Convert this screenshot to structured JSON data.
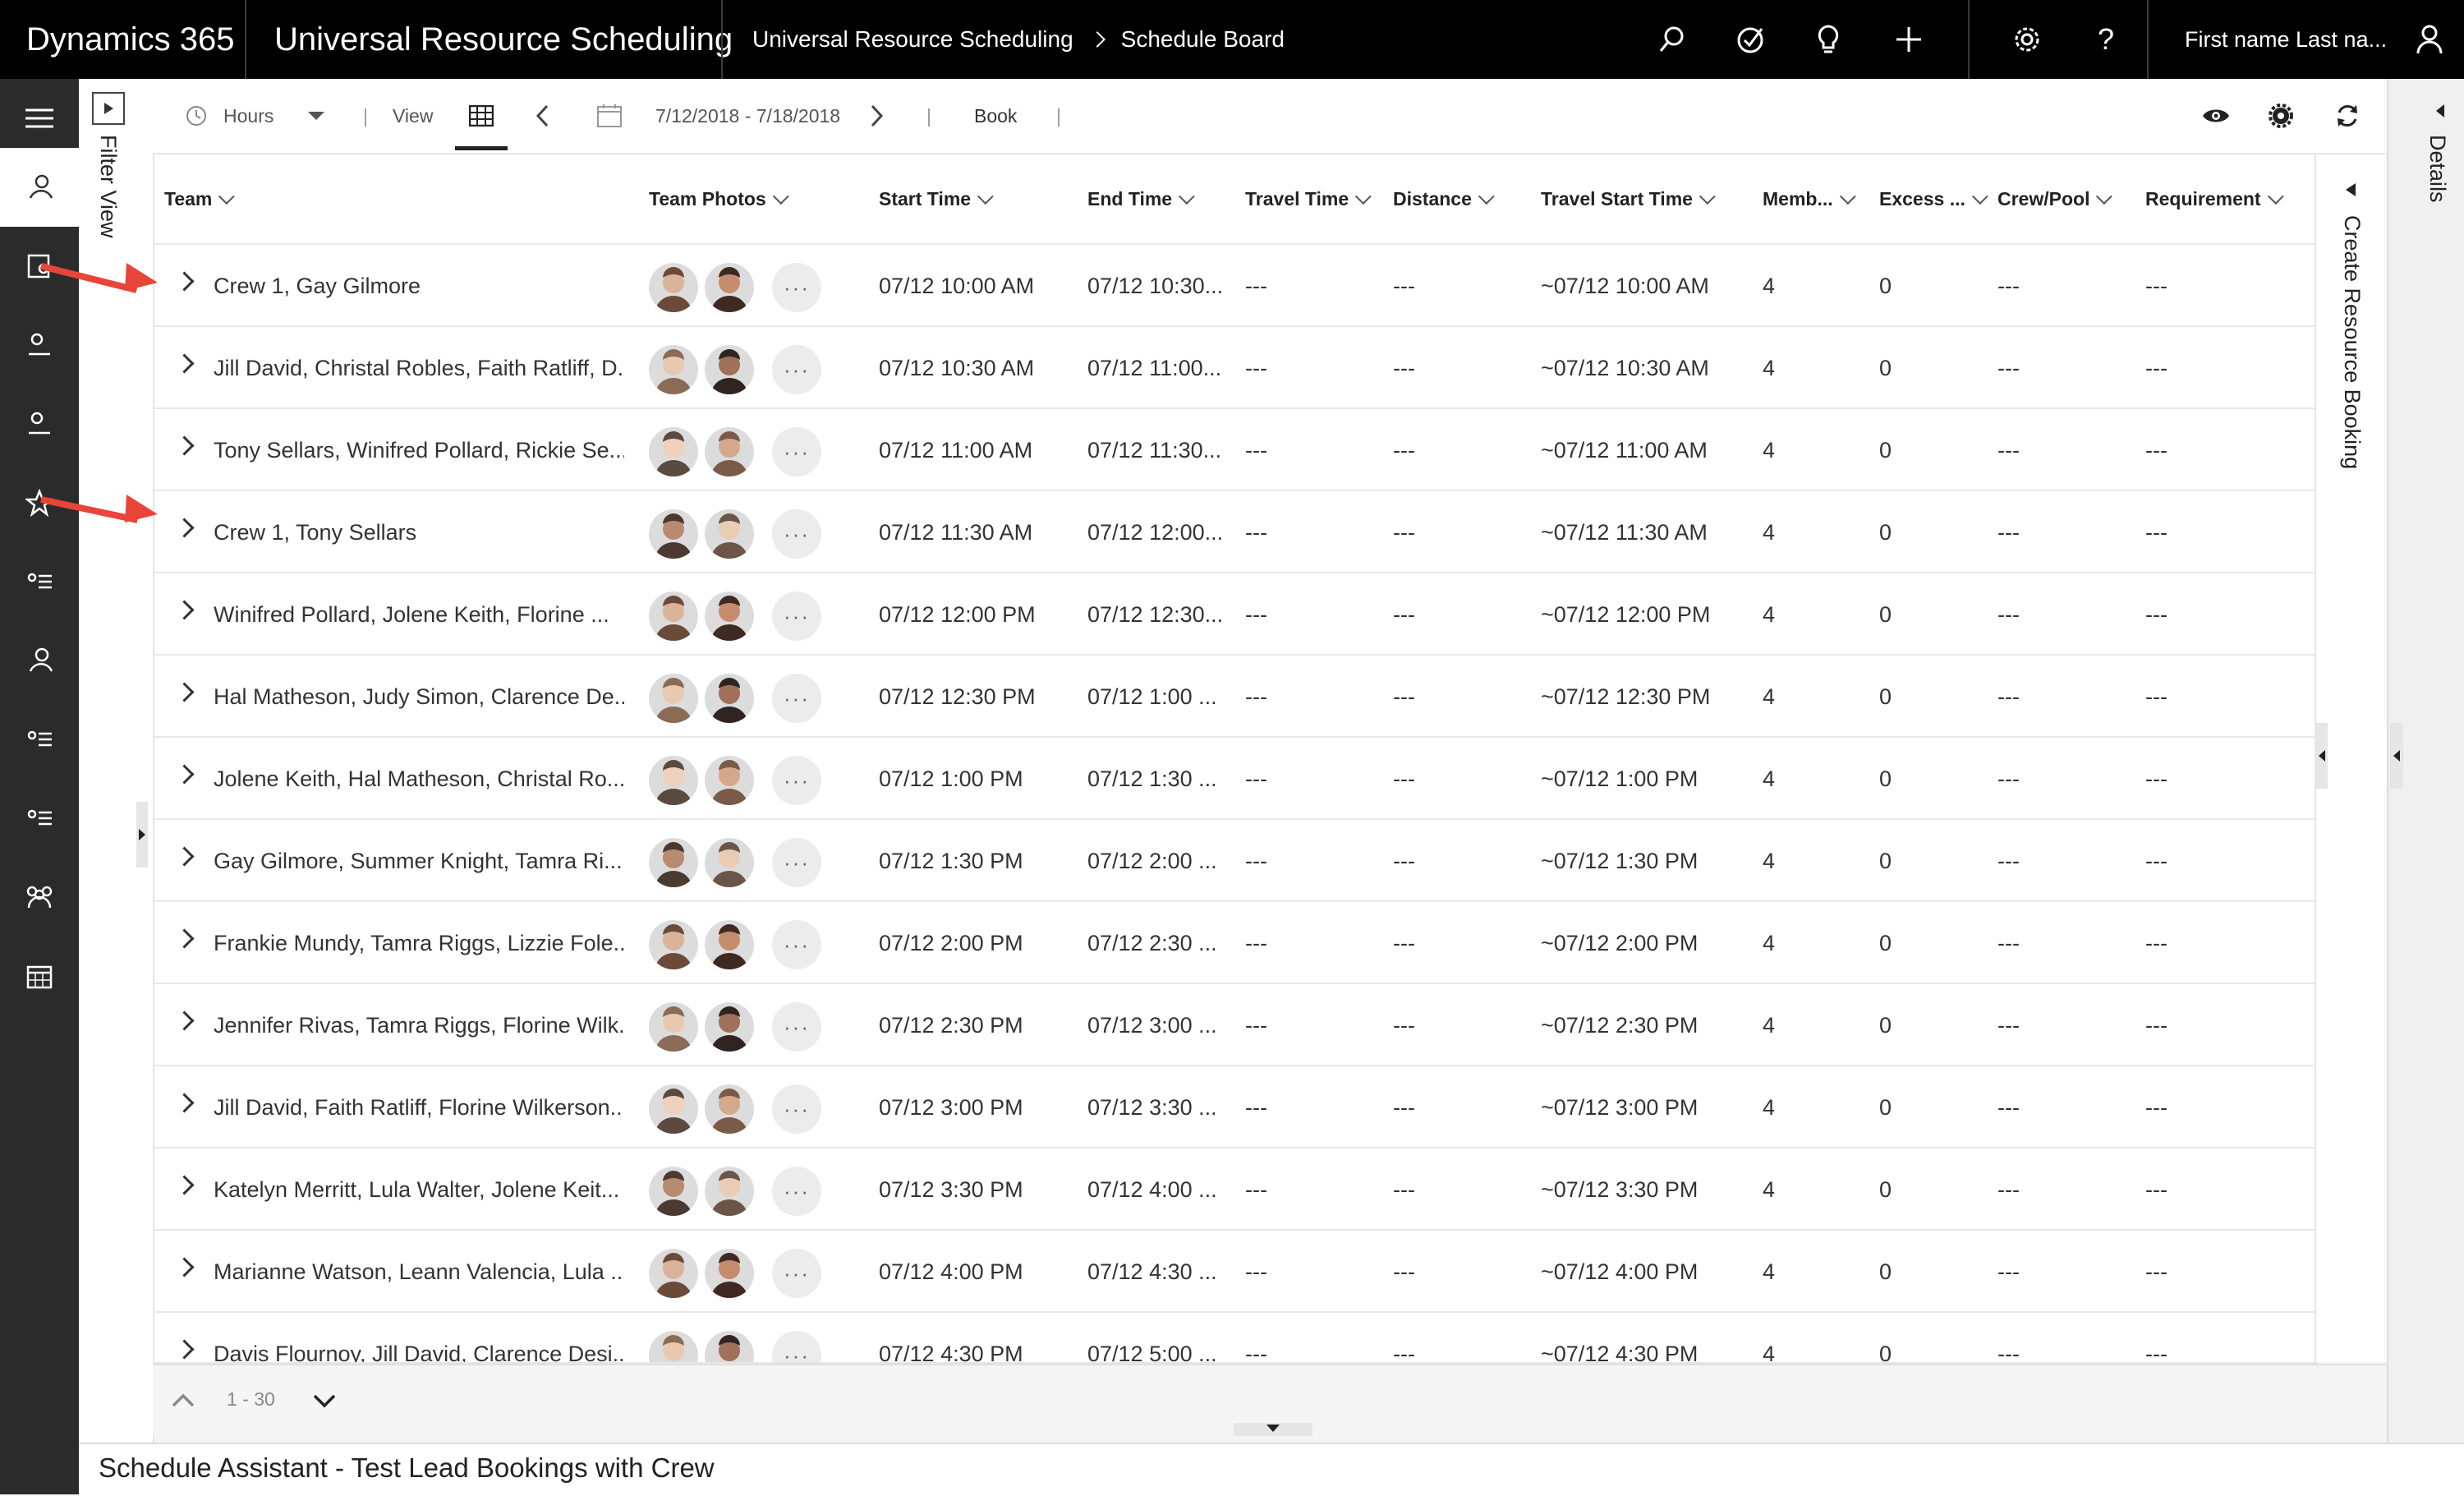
{
  "topbar": {
    "brand": "Dynamics 365",
    "app": "Universal Resource Scheduling",
    "breadcrumb": [
      "Universal Resource Scheduling",
      "Schedule Board"
    ],
    "user": "First name Last na...",
    "icons": [
      "search-icon",
      "task-icon",
      "lightbulb-icon",
      "add-icon",
      "gear-icon",
      "help-icon",
      "user-icon"
    ]
  },
  "filter_panel": {
    "label": "Filter View"
  },
  "toolbar": {
    "hours_label": "Hours",
    "view_label": "View",
    "date_range": "7/12/2018 - 7/18/2018",
    "book_label": "Book"
  },
  "grid": {
    "columns": [
      "Team",
      "Team Photos",
      "Start Time",
      "End Time",
      "Travel Time",
      "Distance",
      "Travel Start Time",
      "Memb...",
      "Excess ...",
      "Crew/Pool",
      "Requirement"
    ],
    "rows": [
      {
        "team": "Crew 1, Gay Gilmore",
        "start": "07/12 10:00 AM",
        "end": "07/12 10:30...",
        "travel": "---",
        "distance": "---",
        "travel_start": "~07/12 10:00 AM",
        "members": "4",
        "excess": "0",
        "crew": "---",
        "requirement": "---"
      },
      {
        "team": "Jill David, Christal Robles, Faith Ratliff, D...",
        "start": "07/12 10:30 AM",
        "end": "07/12 11:00...",
        "travel": "---",
        "distance": "---",
        "travel_start": "~07/12 10:30 AM",
        "members": "4",
        "excess": "0",
        "crew": "---",
        "requirement": "---"
      },
      {
        "team": "Tony Sellars, Winifred Pollard, Rickie Se...",
        "start": "07/12 11:00 AM",
        "end": "07/12 11:30...",
        "travel": "---",
        "distance": "---",
        "travel_start": "~07/12 11:00 AM",
        "members": "4",
        "excess": "0",
        "crew": "---",
        "requirement": "---"
      },
      {
        "team": "Crew 1, Tony Sellars",
        "start": "07/12 11:30 AM",
        "end": "07/12 12:00...",
        "travel": "---",
        "distance": "---",
        "travel_start": "~07/12 11:30 AM",
        "members": "4",
        "excess": "0",
        "crew": "---",
        "requirement": "---"
      },
      {
        "team": "Winifred Pollard, Jolene Keith, Florine ...",
        "start": "07/12 12:00 PM",
        "end": "07/12 12:30...",
        "travel": "---",
        "distance": "---",
        "travel_start": "~07/12 12:00 PM",
        "members": "4",
        "excess": "0",
        "crew": "---",
        "requirement": "---"
      },
      {
        "team": "Hal Matheson, Judy Simon, Clarence De...",
        "start": "07/12 12:30 PM",
        "end": "07/12 1:00 ...",
        "travel": "---",
        "distance": "---",
        "travel_start": "~07/12 12:30 PM",
        "members": "4",
        "excess": "0",
        "crew": "---",
        "requirement": "---"
      },
      {
        "team": "Jolene Keith, Hal Matheson, Christal Ro...",
        "start": "07/12 1:00 PM",
        "end": "07/12 1:30 ...",
        "travel": "---",
        "distance": "---",
        "travel_start": "~07/12 1:00 PM",
        "members": "4",
        "excess": "0",
        "crew": "---",
        "requirement": "---"
      },
      {
        "team": "Gay Gilmore, Summer Knight, Tamra Ri...",
        "start": "07/12 1:30 PM",
        "end": "07/12 2:00 ...",
        "travel": "---",
        "distance": "---",
        "travel_start": "~07/12 1:30 PM",
        "members": "4",
        "excess": "0",
        "crew": "---",
        "requirement": "---"
      },
      {
        "team": "Frankie Mundy, Tamra Riggs, Lizzie Fole...",
        "start": "07/12 2:00 PM",
        "end": "07/12 2:30 ...",
        "travel": "---",
        "distance": "---",
        "travel_start": "~07/12 2:00 PM",
        "members": "4",
        "excess": "0",
        "crew": "---",
        "requirement": "---"
      },
      {
        "team": "Jennifer Rivas, Tamra Riggs, Florine Wilk...",
        "start": "07/12 2:30 PM",
        "end": "07/12 3:00 ...",
        "travel": "---",
        "distance": "---",
        "travel_start": "~07/12 2:30 PM",
        "members": "4",
        "excess": "0",
        "crew": "---",
        "requirement": "---"
      },
      {
        "team": "Jill David, Faith Ratliff, Florine Wilkerson...",
        "start": "07/12 3:00 PM",
        "end": "07/12 3:30 ...",
        "travel": "---",
        "distance": "---",
        "travel_start": "~07/12 3:00 PM",
        "members": "4",
        "excess": "0",
        "crew": "---",
        "requirement": "---"
      },
      {
        "team": "Katelyn Merritt, Lula Walter, Jolene Keit...",
        "start": "07/12 3:30 PM",
        "end": "07/12 4:00 ...",
        "travel": "---",
        "distance": "---",
        "travel_start": "~07/12 3:30 PM",
        "members": "4",
        "excess": "0",
        "crew": "---",
        "requirement": "---"
      },
      {
        "team": "Marianne Watson, Leann Valencia, Lula ...",
        "start": "07/12 4:00 PM",
        "end": "07/12 4:30 ...",
        "travel": "---",
        "distance": "---",
        "travel_start": "~07/12 4:00 PM",
        "members": "4",
        "excess": "0",
        "crew": "---",
        "requirement": "---"
      },
      {
        "team": "Davis Flournoy, Jill David, Clarence Desi...",
        "start": "07/12 4:30 PM",
        "end": "07/12 5:00 ...",
        "travel": "---",
        "distance": "---",
        "travel_start": "~07/12 4:30 PM",
        "members": "4",
        "excess": "0",
        "crew": "---",
        "requirement": "---"
      }
    ]
  },
  "right_panel": {
    "create_label": "Create Resource Booking",
    "details_label": "Details"
  },
  "pager": {
    "range": "1 - 30"
  },
  "status": {
    "title": "Schedule Assistant - Test Lead Bookings with Crew"
  },
  "colors": {
    "topbar": "#000000",
    "rail": "#2b2b2b",
    "annotation_arrow": "#e8443a",
    "selected_tab_underline": "#222222"
  }
}
